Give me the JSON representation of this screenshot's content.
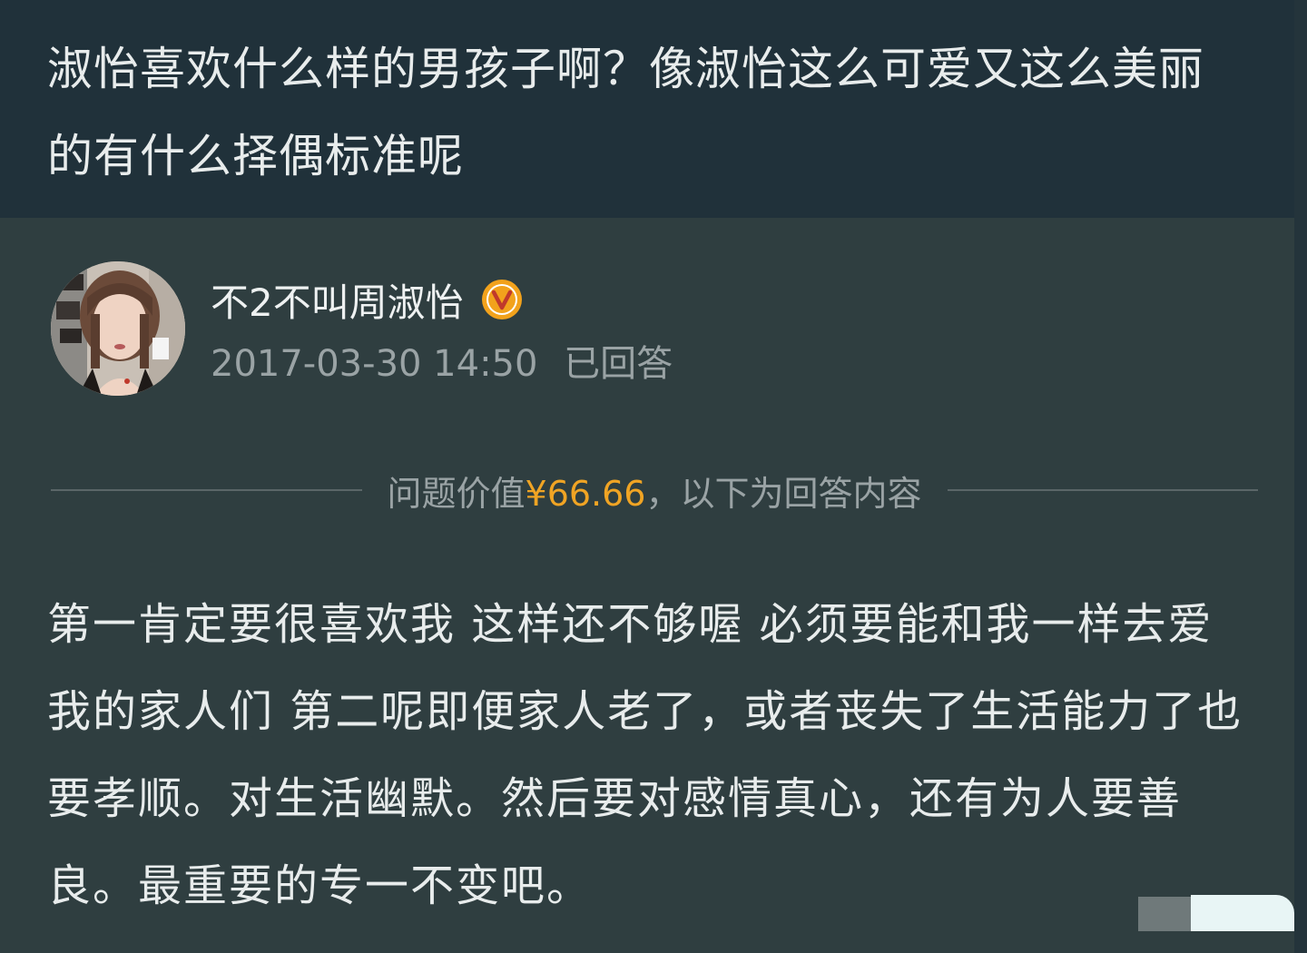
{
  "question": {
    "text": "淑怡喜欢什么样的男孩子啊？像淑怡这么可爱又这么美丽的有什么择偶标准呢"
  },
  "author": {
    "name": "不2不叫周淑怡",
    "verified_icon": "verified-v-badge-icon",
    "avatar_icon": "user-avatar",
    "timestamp": "2017-03-30 14:50",
    "status": "已回答"
  },
  "divider": {
    "prefix": "问题价值",
    "price": "¥66.66",
    "suffix": "，以下为回答内容"
  },
  "answer": {
    "text": "第一肯定要很喜欢我 这样还不够喔 必须要能和我一样去爱我的家人们 第二呢即便家人老了，或者丧失了生活能力了也要孝顺。对生活幽默。然后要对感情真心，还有为人要善良。最重要的专一不变吧。"
  },
  "colors": {
    "header_bg": "#20313a",
    "body_bg": "#2f3e40",
    "price": "#f0a424",
    "verified": "#f2a21c",
    "text": "#e8ecec",
    "muted": "#9aa3a5"
  }
}
